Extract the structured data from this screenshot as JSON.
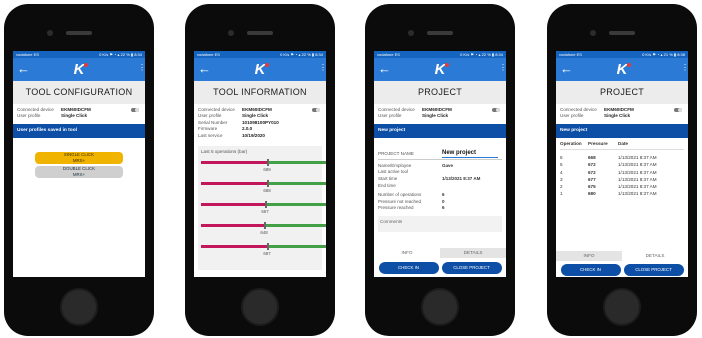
{
  "common": {
    "carrier": "vodafone ES",
    "status_icons": "0 K/s ⚑ ◔ ▴ 22 % ▮ 8:34",
    "status_icons_p4": "0 K/s ⚑ ◔ ▴ 21 % ▮ 8:38",
    "back_icon": "left-arrow-icon",
    "logo_letter": "K",
    "menu_icon": "more-vert-icon",
    "colors": {
      "header": "#2b7bd6",
      "banner": "#0d4ea6",
      "accent_yellow": "#f0b400",
      "bar_red": "#c2185b",
      "bar_green": "#43a047"
    }
  },
  "screen1": {
    "title": "TOOL CONFIGURATION",
    "rows": [
      {
        "label": "Connected device",
        "value": "EKM60IDCFM"
      },
      {
        "label": "User profile",
        "value": "Single Click"
      }
    ],
    "banner": "User profiles saved in tool",
    "buttons": [
      {
        "line1": "SINGLE CLICK",
        "line2": "MRS+"
      },
      {
        "line1": "DOUBLE CLICK",
        "line2": "MRS+"
      }
    ]
  },
  "screen2": {
    "title": "TOOL INFORMATION",
    "rows": [
      {
        "label": "Connected device",
        "value": "EKM60IDCFM"
      },
      {
        "label": "User profile",
        "value": "Single Click"
      },
      {
        "label": "Serial Number",
        "value": "101098100PY010"
      },
      {
        "label": "Firmware",
        "value": "2.0.0"
      },
      {
        "label": "Last service",
        "value": "10/19/2020"
      }
    ],
    "ops_title": "Last 5 operations (bar)",
    "ops": [
      {
        "value": "689",
        "fraction": 0.52
      },
      {
        "value": "688",
        "fraction": 0.52
      },
      {
        "value": "667",
        "fraction": 0.51
      },
      {
        "value": "648",
        "fraction": 0.5
      },
      {
        "value": "687",
        "fraction": 0.52
      }
    ]
  },
  "screen3": {
    "title": "PROJECT",
    "rows": [
      {
        "label": "Connected device",
        "value": "EKM60IDCFM"
      },
      {
        "label": "User profile",
        "value": "Single Click"
      }
    ],
    "banner": "New project",
    "project_name_label": "PROJECT NAME",
    "project_name_value": "New project",
    "details_a": [
      {
        "label": "Name/Employee",
        "value": "Gave"
      },
      {
        "label": "Last active tool",
        "value": ""
      },
      {
        "label": "Start time",
        "value": "1/13/2021 8:37 AM"
      },
      {
        "label": "End time",
        "value": ""
      }
    ],
    "details_b": [
      {
        "label": "Number of operations",
        "value": "6"
      },
      {
        "label": "Pressure not reached",
        "value": "0"
      },
      {
        "label": "Pressure reached",
        "value": "6"
      }
    ],
    "comments_label": "Comments",
    "tabs": [
      "INFO",
      "DETAILS"
    ],
    "check_in": "CHECK IN",
    "close_project": "CLOSE PROJECT"
  },
  "screen4": {
    "title": "PROJECT",
    "rows": [
      {
        "label": "Connected device",
        "value": "EKM60IDCFM"
      },
      {
        "label": "User profile",
        "value": "Single Click"
      }
    ],
    "banner": "New project",
    "columns": [
      "Operation",
      "Pressure",
      "Date"
    ],
    "ops": [
      {
        "op": "6",
        "pressure": "668",
        "date": "1/13/2021 8:37 AM"
      },
      {
        "op": "5",
        "pressure": "672",
        "date": "1/13/2021 8:37 AM"
      },
      {
        "op": "4",
        "pressure": "672",
        "date": "1/13/2021 8:37 AM"
      },
      {
        "op": "3",
        "pressure": "677",
        "date": "1/13/2021 8:37 AM"
      },
      {
        "op": "2",
        "pressure": "675",
        "date": "1/13/2021 8:37 AM"
      },
      {
        "op": "1",
        "pressure": "680",
        "date": "1/13/2021 8:37 AM"
      }
    ],
    "tabs": [
      "INFO",
      "DETAILS"
    ],
    "check_in": "CHECK IN",
    "close_project": "CLOSE PROJECT"
  }
}
